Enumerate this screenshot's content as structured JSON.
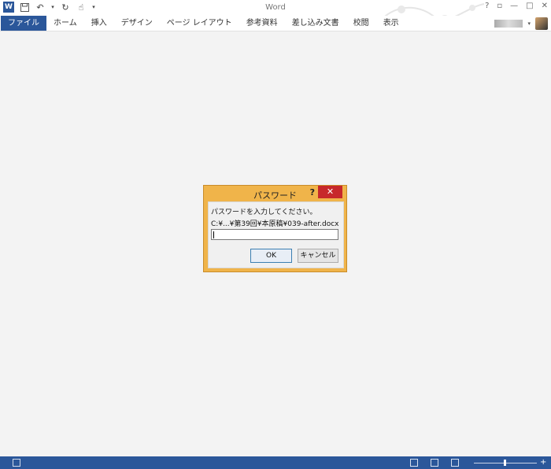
{
  "window": {
    "title": "Word",
    "help_symbol": "?",
    "controls": [
      "?",
      "▫",
      "—",
      "□",
      "✕"
    ]
  },
  "ribbon": {
    "tabs": [
      "ファイル",
      "ホーム",
      "挿入",
      "デザイン",
      "ページ レイアウト",
      "参考資料",
      "差し込み文書",
      "校閲",
      "表示"
    ]
  },
  "dialog": {
    "title": "パスワード",
    "help": "?",
    "close": "✕",
    "prompt": "パスワードを入力してください。",
    "path": "C:¥...¥第39回¥本原稿¥039-after.docx",
    "password_value": "",
    "ok_label": "OK",
    "cancel_label": "キャンセル"
  },
  "colors": {
    "accent": "#2b579a",
    "dialog_frame": "#f0b44a",
    "close_button": "#c7282b"
  }
}
